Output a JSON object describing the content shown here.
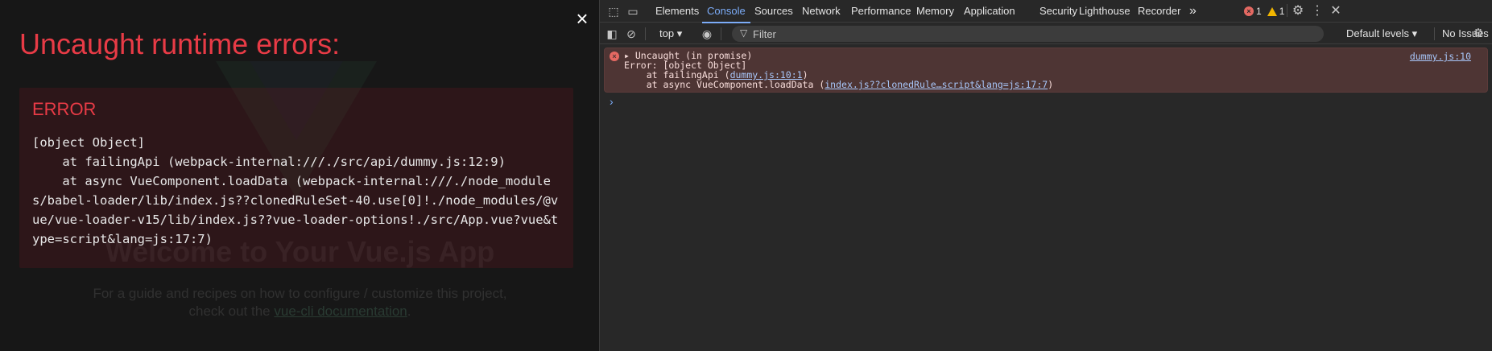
{
  "overlay": {
    "title": "Uncaught runtime errors:",
    "close_symbol": "×",
    "error_heading": "ERROR",
    "error_message": "[object Object]\n    at failingApi (webpack-internal:///./src/api/dummy.js:12:9)\n    at async VueComponent.loadData (webpack-internal:///./node_modules/babel-loader/lib/index.js??clonedRuleSet-40.use[0]!./node_modules/@vue/vue-loader-v15/lib/index.js??vue-loader-options!./src/App.vue?vue&type=script&lang=js:17:7)"
  },
  "background_page": {
    "welcome": "Welcome to Your Vue.js App",
    "guide_line1": "For a guide and recipes on how to configure / customize this project,",
    "guide_line2_prefix": "check out the ",
    "guide_link": "vue-cli documentation",
    "guide_line2_suffix": "."
  },
  "devtools": {
    "tabs": [
      "Elements",
      "Console",
      "Sources",
      "Network",
      "Performance",
      "Memory",
      "Application",
      "Security",
      "Lighthouse",
      "Recorder"
    ],
    "more_tabs": "»",
    "error_count": "1",
    "warning_count": "1",
    "context": "top",
    "filter_placeholder": "Filter",
    "levels": "Default levels",
    "issues": "No Issues",
    "console": {
      "header": "Uncaught (in promise)",
      "source": "dummy.js:10",
      "error_line": "Error: [object Object]",
      "stack1_prefix": "    at failingApi (",
      "stack1_link": "dummy.js:10:1",
      "stack1_suffix": ")",
      "stack2_prefix": "    at async VueComponent.loadData (",
      "stack2_link": "index.js??clonedRule…script&lang=js:17:7",
      "stack2_suffix": ")"
    }
  },
  "colors": {
    "error_red": "#e83b46",
    "active_tab": "#7cacf8",
    "link": "#a8c7fa"
  }
}
